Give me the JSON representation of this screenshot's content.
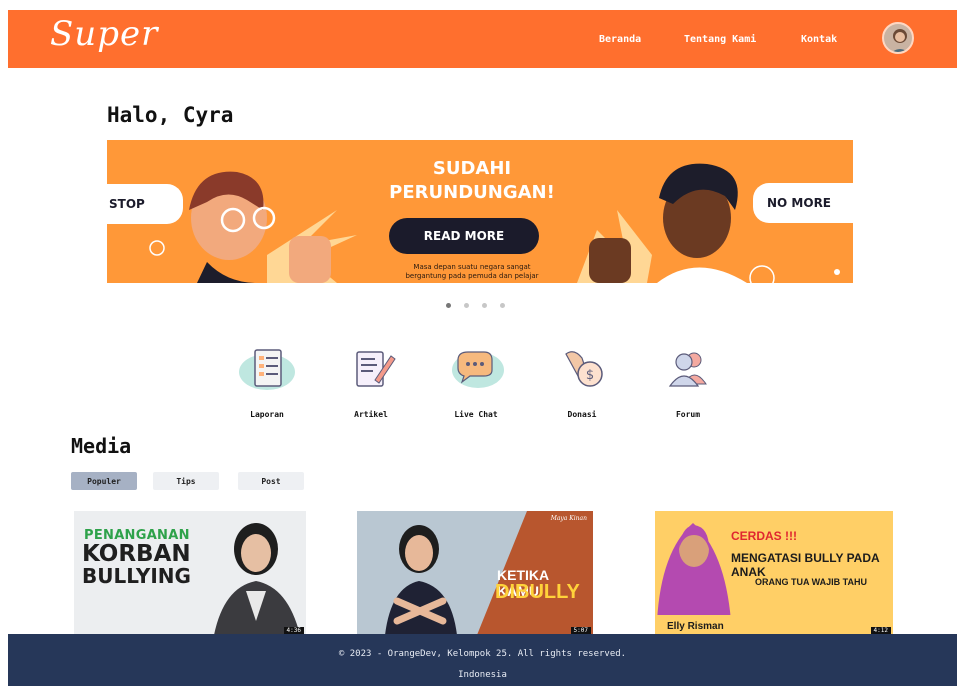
{
  "header": {
    "logo": "Super",
    "nav": [
      "Beranda",
      "Tentang Kami",
      "Kontak"
    ],
    "bg_color": "#ff6f2e"
  },
  "greeting": "Halo, Cyra",
  "banner": {
    "title_line1": "SUDAHI",
    "title_line2": "PERUNDUNGAN!",
    "button": "READ MORE",
    "caption_line1": "Masa depan suatu negara sangat",
    "caption_line2": "bergantung pada pemuda dan pelajar",
    "left_bubble": "STOP",
    "right_bubble": "NO MORE",
    "slide_count": 4,
    "active_slide": 1
  },
  "features": [
    {
      "label": "Laporan",
      "icon": "report-icon"
    },
    {
      "label": "Artikel",
      "icon": "article-icon"
    },
    {
      "label": "Live Chat",
      "icon": "chat-icon"
    },
    {
      "label": "Donasi",
      "icon": "donation-icon"
    },
    {
      "label": "Forum",
      "icon": "forum-icon"
    }
  ],
  "media": {
    "title": "Media",
    "tabs": [
      "Populer",
      "Tips",
      "Post"
    ],
    "active_tab": "Populer",
    "cards": [
      {
        "line1": "PENANGANAN",
        "line2": "KORBAN",
        "line3": "BULLYING",
        "duration": "4:36"
      },
      {
        "line1": "KETIKA KAMU",
        "line2": "DIBULLY",
        "tag": "Maya Kinan",
        "duration": "5:07"
      },
      {
        "line1": "CERDAS !!!",
        "line2": "MENGATASI BULLY PADA ANAK",
        "line3": "ORANG TUA WAJIB TAHU",
        "name": "Elly Risman",
        "duration": "4:12"
      }
    ]
  },
  "footer": {
    "line1": "© 2023 - OrangeDev, Kelompok 25. All rights reserved.",
    "line2": "Indonesia"
  }
}
